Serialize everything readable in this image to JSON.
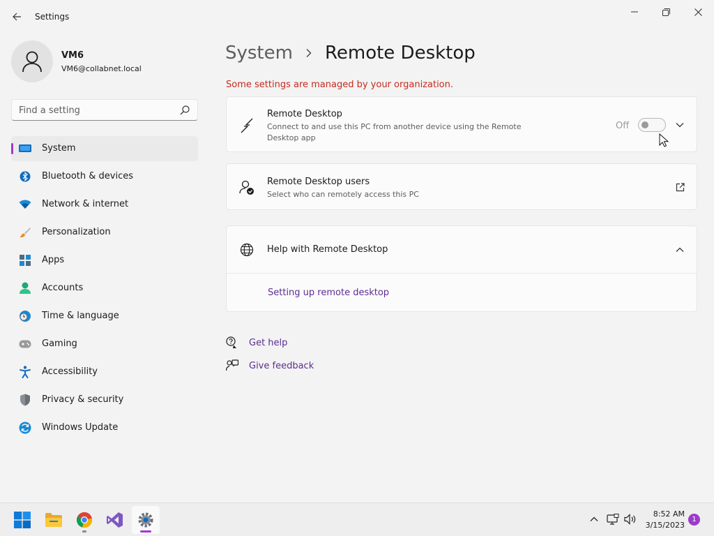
{
  "window": {
    "title": "Settings"
  },
  "profile": {
    "name": "VM6",
    "email": "VM6@collabnet.local"
  },
  "search": {
    "placeholder": "Find a setting"
  },
  "nav": {
    "items": [
      {
        "label": "System",
        "icon": "system-icon",
        "selected": true
      },
      {
        "label": "Bluetooth & devices",
        "icon": "bluetooth-icon"
      },
      {
        "label": "Network & internet",
        "icon": "wifi-icon"
      },
      {
        "label": "Personalization",
        "icon": "brush-icon"
      },
      {
        "label": "Apps",
        "icon": "apps-icon"
      },
      {
        "label": "Accounts",
        "icon": "accounts-icon"
      },
      {
        "label": "Time & language",
        "icon": "clock-globe-icon"
      },
      {
        "label": "Gaming",
        "icon": "gamepad-icon"
      },
      {
        "label": "Accessibility",
        "icon": "accessibility-icon"
      },
      {
        "label": "Privacy & security",
        "icon": "shield-icon"
      },
      {
        "label": "Windows Update",
        "icon": "update-icon"
      }
    ]
  },
  "breadcrumb": {
    "parent": "System",
    "current": "Remote Desktop"
  },
  "warning": "Some settings are managed by your organization.",
  "remote_desktop": {
    "title": "Remote Desktop",
    "description": "Connect to and use this PC from another device using the Remote Desktop app",
    "toggle_label": "Off",
    "toggle_on": false
  },
  "remote_users": {
    "title": "Remote Desktop users",
    "description": "Select who can remotely access this PC"
  },
  "help": {
    "title": "Help with Remote Desktop",
    "link": "Setting up remote desktop"
  },
  "footer": {
    "get_help": "Get help",
    "give_feedback": "Give feedback"
  },
  "taskbar": {
    "apps": [
      "start-icon",
      "file-explorer-icon",
      "chrome-icon",
      "visual-studio-icon",
      "settings-icon"
    ],
    "time": "8:52 AM",
    "date": "3/15/2023",
    "notification_count": "1"
  },
  "colors": {
    "accent": "#9b3bcc",
    "link": "#5c2d91",
    "warning": "#c42b1c"
  }
}
